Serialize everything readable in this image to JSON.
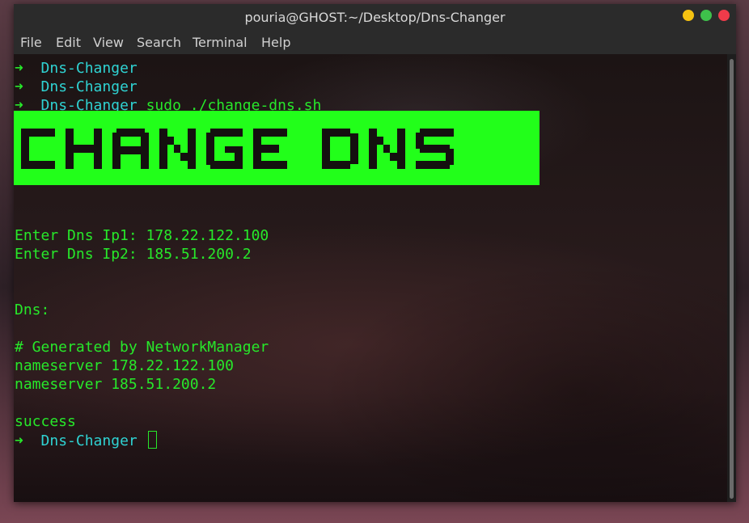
{
  "window": {
    "title": "pouria@GHOST:~/Desktop/Dns-Changer",
    "controls": [
      "minimize",
      "maximize",
      "close"
    ]
  },
  "menubar": {
    "items": [
      "File",
      "Edit",
      "View",
      "Search",
      "Terminal",
      "Help"
    ]
  },
  "terminal": {
    "prompt_symbol": "➜",
    "lines": [
      {
        "type": "prompt",
        "dir": "Dns-Changer",
        "cmd": ""
      },
      {
        "type": "prompt",
        "dir": "Dns-Changer",
        "cmd": ""
      },
      {
        "type": "prompt",
        "dir": "Dns-Changer",
        "cmd": "sudo ./change-dns.sh"
      }
    ],
    "banner_text": "CHANGE DNS",
    "output": {
      "ip1": "Enter Dns Ip1: 178.22.122.100",
      "ip2": "Enter Dns Ip2: 185.51.200.2",
      "dns_label": "Dns:",
      "generated": "# Generated by NetworkManager",
      "ns1": "nameserver 178.22.122.100",
      "ns2": "nameserver 185.51.200.2",
      "status": "success"
    },
    "final_prompt": {
      "dir": "Dns-Changer"
    }
  },
  "colors": {
    "green": "#27e82a",
    "cyan": "#2fd3d3",
    "banner_bg": "#22ff1a"
  }
}
